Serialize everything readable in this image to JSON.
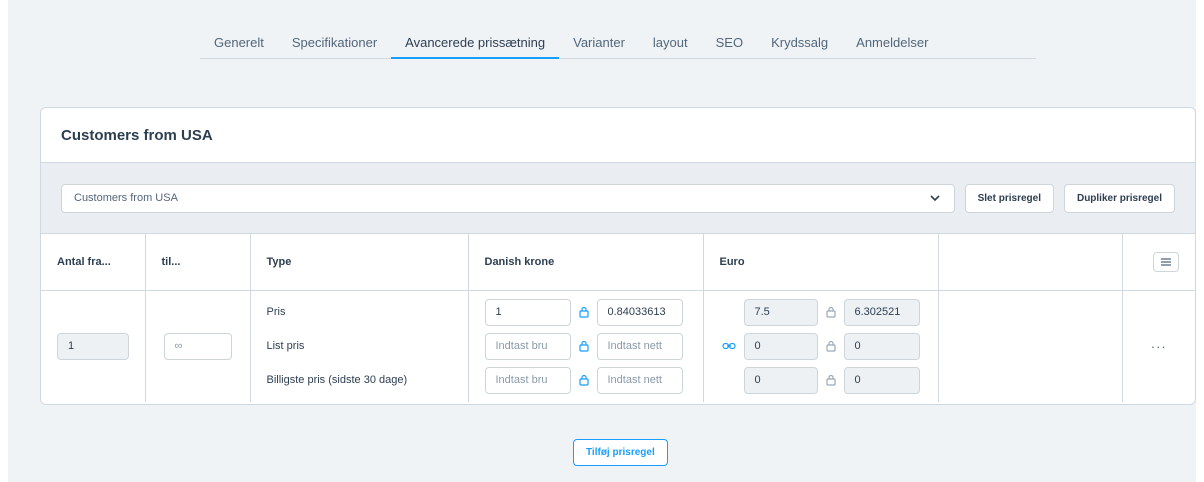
{
  "tabs": [
    {
      "label": "Generelt",
      "active": false
    },
    {
      "label": "Specifikationer",
      "active": false
    },
    {
      "label": "Avancerede prissætning",
      "active": true
    },
    {
      "label": "Varianter",
      "active": false
    },
    {
      "label": "layout",
      "active": false
    },
    {
      "label": "SEO",
      "active": false
    },
    {
      "label": "Krydssalg",
      "active": false
    },
    {
      "label": "Anmeldelser",
      "active": false
    }
  ],
  "card": {
    "title": "Customers from USA",
    "rule_select_value": "Customers from USA",
    "delete_rule_label": "Slet prisregel",
    "duplicate_rule_label": "Dupliker prisregel"
  },
  "table": {
    "headers": {
      "from": "Antal fra...",
      "to": "til...",
      "type": "Type",
      "dkk": "Danish krone",
      "eur": "Euro"
    },
    "row": {
      "quantity_from": "1",
      "quantity_to_placeholder": "∞",
      "types": [
        "Pris",
        "List pris",
        "Billigste pris (sidste 30 dage)"
      ],
      "dkk": [
        {
          "gross": "1",
          "net": "0.84033613",
          "gross_placeholder": "",
          "net_placeholder": ""
        },
        {
          "gross": "",
          "net": "",
          "gross_placeholder": "Indtast bru",
          "net_placeholder": "Indtast nett"
        },
        {
          "gross": "",
          "net": "",
          "gross_placeholder": "Indtast bru",
          "net_placeholder": "Indtast nett"
        }
      ],
      "eur": [
        {
          "gross": "7.5",
          "net": "6.302521"
        },
        {
          "gross": "0",
          "net": "0"
        },
        {
          "gross": "0",
          "net": "0"
        }
      ],
      "actions_label": "···"
    }
  },
  "add_rule_label": "Tilføj prisregel",
  "colors": {
    "accent": "#189eff",
    "background": "#f0f3f6",
    "border": "#d1d9e0"
  }
}
